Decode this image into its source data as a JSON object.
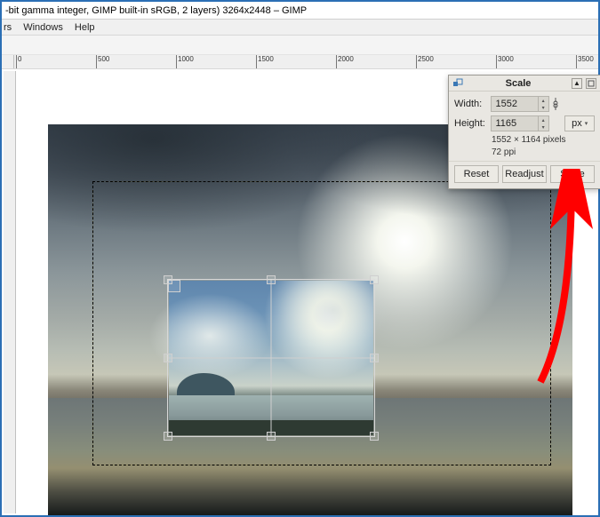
{
  "titlebar": "-bit gamma integer, GIMP built-in sRGB, 2 layers) 3264x2448 – GIMP",
  "menus": {
    "filters": "rs",
    "windows": "Windows",
    "help": "Help"
  },
  "ruler_h": [
    "0",
    "500",
    "1000",
    "1500",
    "2000",
    "2500",
    "3000",
    "3500"
  ],
  "dialog": {
    "title": "Scale",
    "width_label": "Width:",
    "height_label": "Height:",
    "width_value": "1552",
    "height_value": "1165",
    "unit": "px",
    "meta_size": "1552 × 1164 pixels",
    "meta_ppi": "72 ppi",
    "btn_reset": "Reset",
    "btn_readjust": "Readjust",
    "btn_scale": "Scale"
  }
}
